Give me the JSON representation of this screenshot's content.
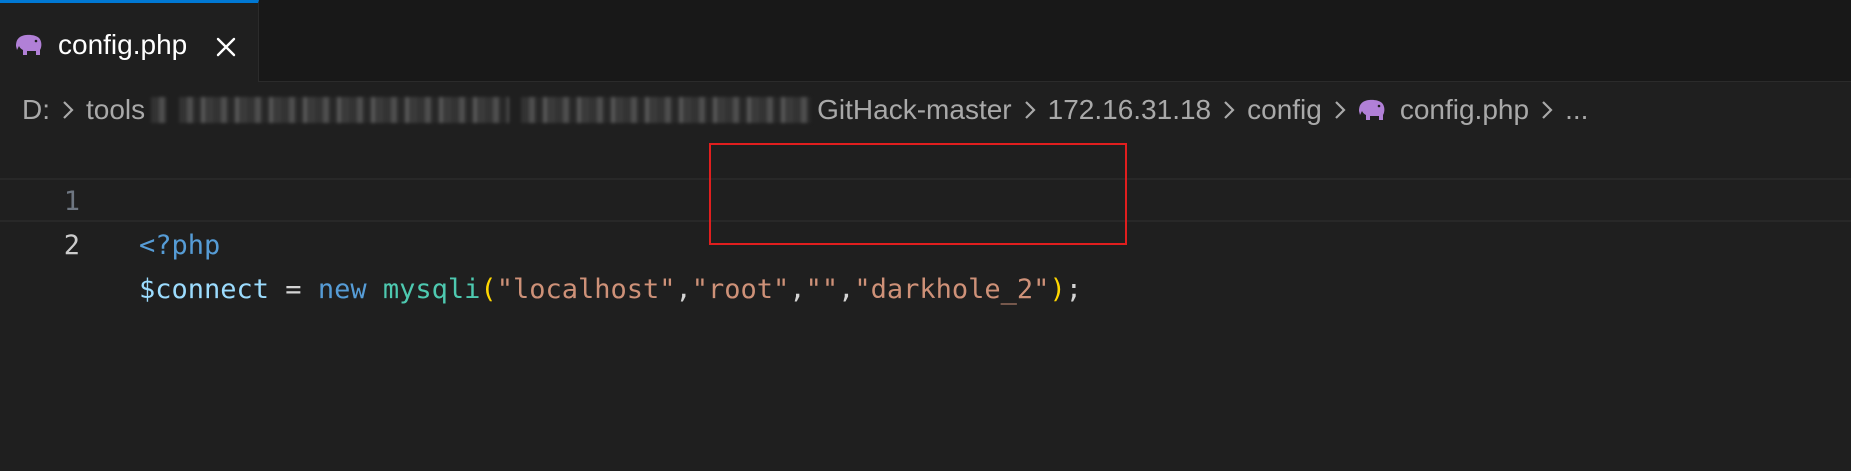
{
  "tab": {
    "label": "config.php",
    "icon": "php-elephant-icon",
    "accent_color": "#0078d4"
  },
  "breadcrumb": {
    "drive": "D:",
    "folder1": "tools",
    "folder_repo": "GitHack-master",
    "folder_ip": "172.16.31.18",
    "folder_config": "config",
    "file": "config.php",
    "more": "..."
  },
  "editor": {
    "line_numbers": [
      "1",
      "2"
    ],
    "line1": {
      "open_tag": "<?php"
    },
    "line2": {
      "var": "$connect",
      "eq": " = ",
      "kw_new": "new",
      "space": " ",
      "fn": "mysqli",
      "paren_open": "(",
      "arg1": "\"localhost\"",
      "comma1": ",",
      "arg2": "\"root\"",
      "comma2": ",",
      "arg3": "\"\"",
      "comma3": ",",
      "arg4": "\"darkhole_2\"",
      "paren_close": ")",
      "semicolon": ";"
    }
  },
  "colors": {
    "highlight_box": "#e01e1e",
    "php_icon": "#b180d7"
  }
}
